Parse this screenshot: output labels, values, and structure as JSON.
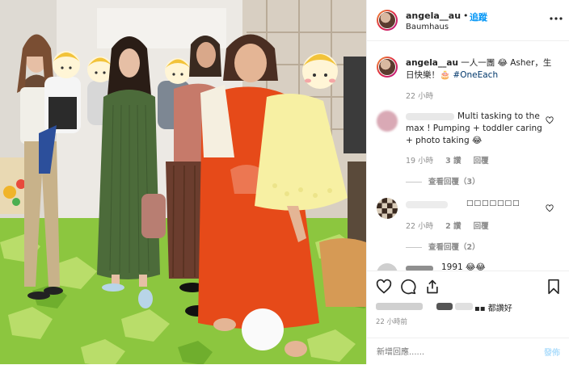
{
  "post": {
    "username": "angela__au",
    "follow_sep": "•",
    "follow_label": "追蹤",
    "location": "Baumhaus",
    "caption_text": "一人一團 😂 Asher，生日快樂！🎂",
    "caption_hashtag": "#OneEach",
    "caption_time": "22 小時",
    "timestamp": "22 小時前"
  },
  "comments": [
    {
      "text": "Multi tasking to the max ! Pumping + toddler caring + photo taking 😂",
      "time": "19 小時",
      "likes": "3 讚",
      "reply_label": "回覆",
      "view_replies": "查看回覆（3）"
    },
    {
      "text": "□□□□□□□",
      "time": "22 小時",
      "likes": "2 讚",
      "reply_label": "回覆",
      "view_replies": "查看回覆（2）"
    }
  ],
  "partial_comment": "1991 😂😂",
  "liked_by": "▪▪ 都讚好",
  "add_comment": {
    "placeholder": "新增回應......",
    "post_label": "發佈"
  },
  "colors": {
    "link": "#0095f6",
    "hashtag": "#00376b",
    "muted": "#8e8e8e",
    "text": "#262626",
    "post_disabled": "#b2dffc"
  },
  "icons": [
    "more-icon",
    "heart-icon",
    "comment-icon",
    "share-icon",
    "bookmark-icon"
  ]
}
